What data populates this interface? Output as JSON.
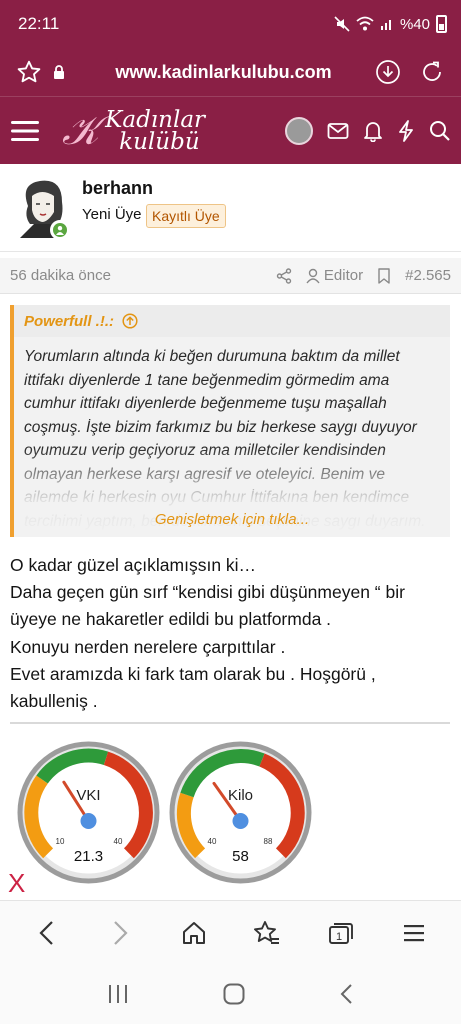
{
  "status": {
    "time": "22:11",
    "battery": "%40"
  },
  "browser": {
    "url": "www.kadinlarkulubu.com"
  },
  "site": {
    "logo_line1": "Kadınlar",
    "logo_line2": "kulübü"
  },
  "user": {
    "name": "berhann",
    "title": "Yeni Üye",
    "badge": "Kayıtlı Üye"
  },
  "post": {
    "time_ago": "56 dakika önce",
    "editor_label": "Editor",
    "post_number": "#2.565",
    "quote": {
      "author": "Powerfull .!.:",
      "text": "Yorumların altında ki beğen durumuna baktım da millet ittifakı diyenlerde 1 tane beğenmedim görmedim ama cumhur ittifakı diyenlerde beğenmeme tuşu maşallah coşmuş. İşte bizim farkımız bu biz herkese saygı duyuyor oyumuzu verip geçiyoruz ama milletciler kendisinden olmayan herkese karşı agresif ve oteleyici. Benim ve ailemde ki herkesin oyu Cumhur İttifakına ben kendimce tercihimi yaptım, ben de kimsenin seçimine saygı duyarım. Rabbim",
      "expand_label": "Genişletmek için tıkla..."
    },
    "lines": [
      "O kadar güzel açıklamışsın ki…",
      "Daha geçen gün sırf “kendisi gibi düşünmeyen “ bir üyeye ne hakaretler edildi bu platformda .",
      "Konuyu nerden nerelere çarpıttılar .",
      "Evet aramızda ki fark tam olarak bu . Hoşgörü , kabulleniş ."
    ]
  },
  "gauges": [
    {
      "label": "VKI",
      "min": "10",
      "max": "40",
      "value": "21.3",
      "fraction": 0.38
    },
    {
      "label": "Kilo",
      "min": "40",
      "max": "88",
      "value": "58",
      "fraction": 0.37
    }
  ],
  "close_label": "X",
  "colors": {
    "brand": "#8a1f45",
    "accent": "#e39514",
    "online": "#5aa63f"
  }
}
